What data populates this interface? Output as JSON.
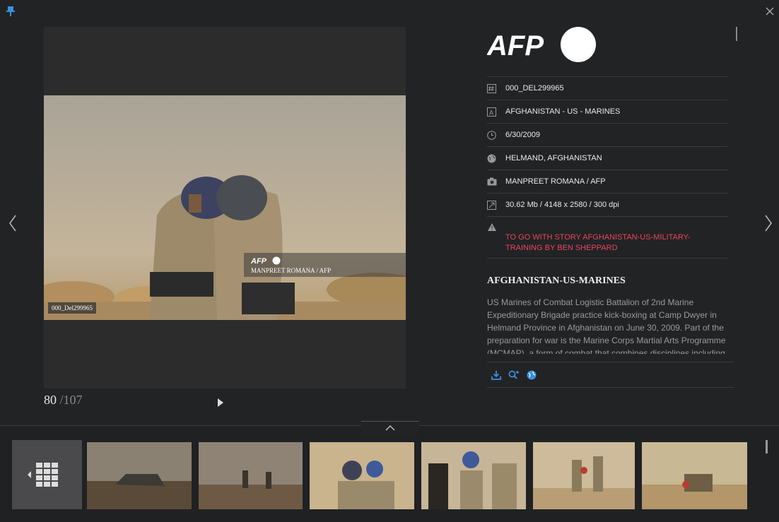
{
  "header": {
    "pin_icon": "pin-icon",
    "close_icon": "close-icon"
  },
  "counter": {
    "current": "80",
    "total": "/107"
  },
  "photo": {
    "watermark_brand": "AFP",
    "watermark_credit": "MANPREET ROMANA / AFP",
    "ref_tag": "000_Del299965"
  },
  "brand": {
    "logo_text": "AFP"
  },
  "meta": {
    "id": "000_DEL299965",
    "title": "AFGHANISTAN - US - MARINES",
    "date": "6/30/2009",
    "location": "HELMAND, AFGHANISTAN",
    "credit": "MANPREET ROMANA / AFP",
    "size": "30.62 Mb / 4148 x 2580 / 300 dpi",
    "warning": "TO GO WITH STORY AFGHANISTAN-US-MILITARY-TRAINING BY BEN SHEPPARD"
  },
  "headline": "AFGHANISTAN-US-MARINES",
  "caption": "US Marines of Combat Logistic Battalion of 2nd Marine Expeditionary Brigade practice kick-boxing at Camp Dwyer in Helmand Province in Afghanistan on June 30, 2009. Part of the preparation for war is the Marine Corps Martial Arts Programme (MCMAP), a form of combat that combines disciplines including",
  "actions": [
    "download-icon",
    "similar-search-icon",
    "globe-icon"
  ],
  "colors": {
    "accent_blue": "#3b8fd9",
    "warning_red": "#e8445e",
    "background": "#222325"
  }
}
